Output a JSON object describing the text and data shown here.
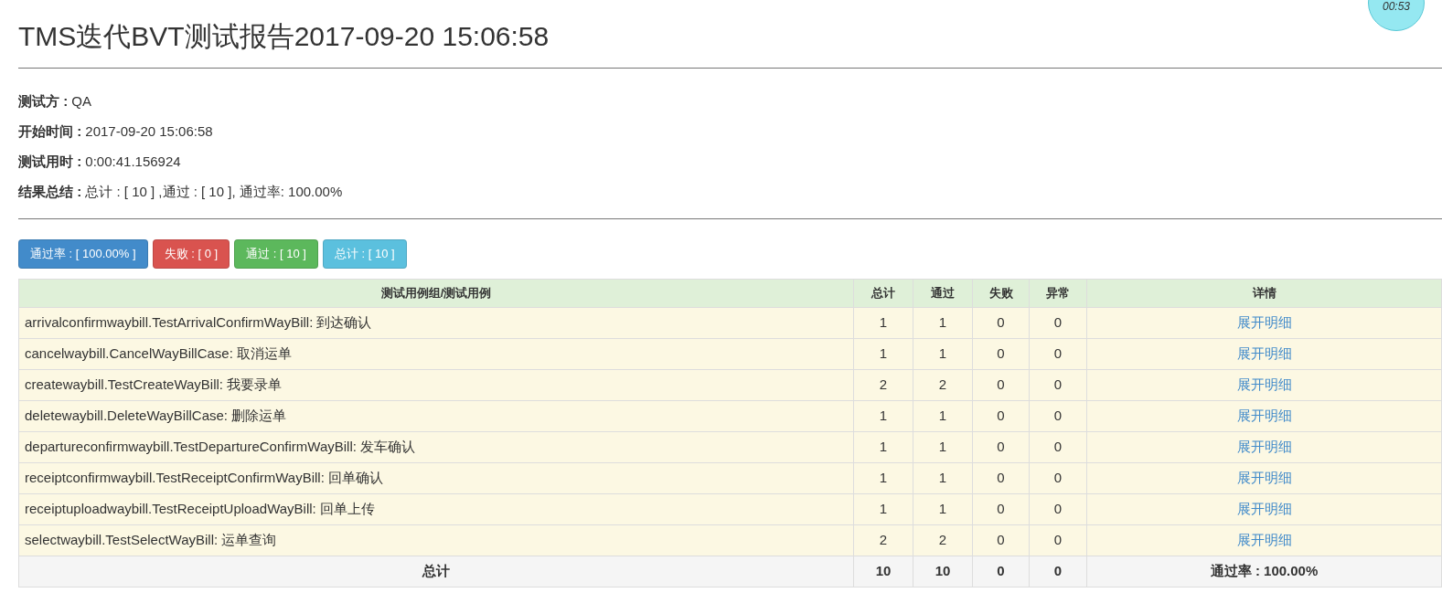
{
  "timer": "00:53",
  "title": "TMS迭代BVT测试报告2017-09-20 15:06:58",
  "info": [
    {
      "label": "测试方 :",
      "value": "QA"
    },
    {
      "label": "开始时间 :",
      "value": "2017-09-20 15:06:58"
    },
    {
      "label": "测试用时 :",
      "value": "0:00:41.156924"
    },
    {
      "label": "结果总结 :",
      "value": "总计 : [ 10 ] ,通过 : [ 10 ], 通过率: 100.00%"
    }
  ],
  "filters": [
    {
      "label": "通过率 : [ 100.00% ]",
      "color": "#428bca"
    },
    {
      "label": "失败 : [ 0 ]",
      "color": "#d9534f"
    },
    {
      "label": "通过 : [ 10 ]",
      "color": "#5cb85c"
    },
    {
      "label": "总计 : [ 10 ]",
      "color": "#5bc0de"
    }
  ],
  "table": {
    "columns": [
      "测试用例组/测试用例",
      "总计",
      "通过",
      "失败",
      "异常",
      "详情"
    ],
    "rows": [
      [
        "arrivalconfirmwaybill.TestArrivalConfirmWayBill: 到达确认",
        "1",
        "1",
        "0",
        "0",
        "展开明细"
      ],
      [
        "cancelwaybill.CancelWayBillCase: 取消运单",
        "1",
        "1",
        "0",
        "0",
        "展开明细"
      ],
      [
        "createwaybill.TestCreateWayBill: 我要录单",
        "2",
        "2",
        "0",
        "0",
        "展开明细"
      ],
      [
        "deletewaybill.DeleteWayBillCase: 删除运单",
        "1",
        "1",
        "0",
        "0",
        "展开明细"
      ],
      [
        "departureconfirmwaybill.TestDepartureConfirmWayBill: 发车确认",
        "1",
        "1",
        "0",
        "0",
        "展开明细"
      ],
      [
        "receiptconfirmwaybill.TestReceiptConfirmWayBill: 回单确认",
        "1",
        "1",
        "0",
        "0",
        "展开明细"
      ],
      [
        "receiptuploadwaybill.TestReceiptUploadWayBill: 回单上传",
        "1",
        "1",
        "0",
        "0",
        "展开明细"
      ],
      [
        "selectwaybill.TestSelectWayBill: 运单查询",
        "2",
        "2",
        "0",
        "0",
        "展开明细"
      ]
    ],
    "footer": [
      "总计",
      "10",
      "10",
      "0",
      "0",
      "通过率 : 100.00%"
    ]
  }
}
